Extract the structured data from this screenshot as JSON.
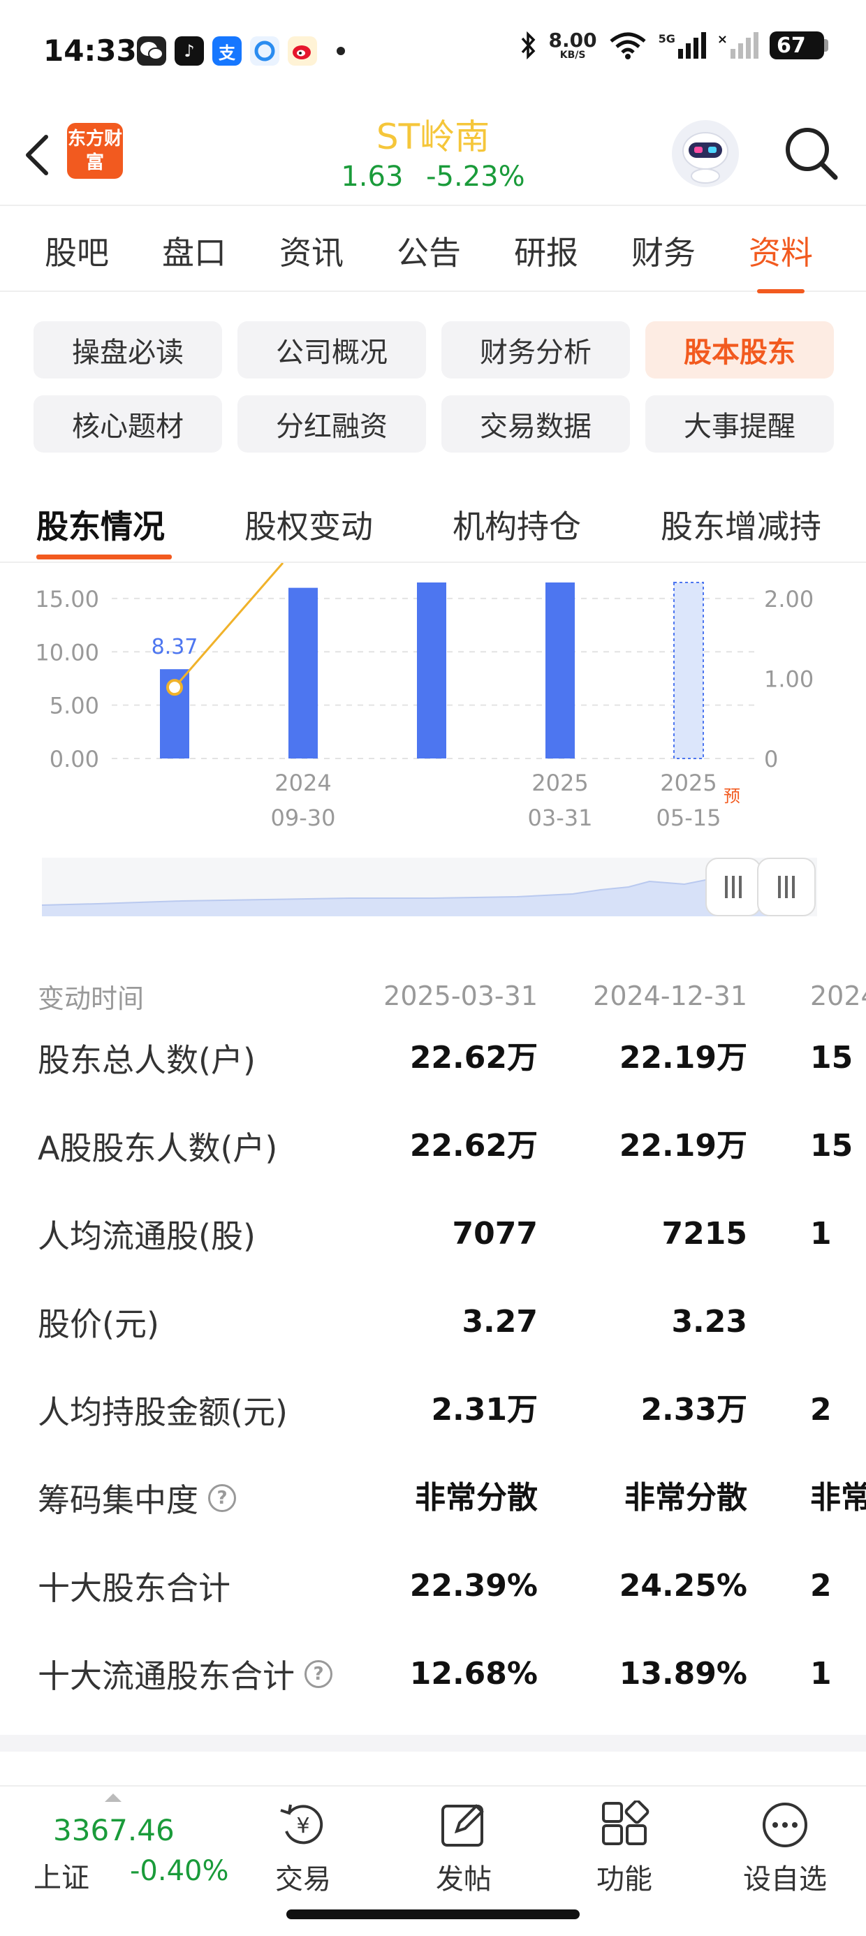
{
  "status_bar": {
    "time": "14:33",
    "net_speed": "8.00",
    "net_unit": "KB/S",
    "signal": "5G",
    "battery": "67"
  },
  "header": {
    "logo_text": "东方财富",
    "stock_name": "ST岭南",
    "price": "1.63",
    "change_pct": "-5.23%"
  },
  "main_tabs": [
    {
      "label": "股吧",
      "active": false
    },
    {
      "label": "盘口",
      "active": false
    },
    {
      "label": "资讯",
      "active": false
    },
    {
      "label": "公告",
      "active": false
    },
    {
      "label": "研报",
      "active": false
    },
    {
      "label": "财务",
      "active": false
    },
    {
      "label": "资料",
      "active": true
    }
  ],
  "chips": [
    {
      "label": "操盘必读",
      "active": false
    },
    {
      "label": "公司概况",
      "active": false
    },
    {
      "label": "财务分析",
      "active": false
    },
    {
      "label": "股本股东",
      "active": true
    },
    {
      "label": "核心题材",
      "active": false
    },
    {
      "label": "分红融资",
      "active": false
    },
    {
      "label": "交易数据",
      "active": false
    },
    {
      "label": "大事提醒",
      "active": false
    }
  ],
  "sub_tabs": [
    {
      "label": "股东情况",
      "active": true
    },
    {
      "label": "股权变动",
      "active": false
    },
    {
      "label": "机构持仓",
      "active": false
    },
    {
      "label": "股东增减持",
      "active": false
    }
  ],
  "chart_data": {
    "type": "bar",
    "left_axis_ticks": [
      "15.00",
      "10.00",
      "5.00",
      "0.00"
    ],
    "right_axis_ticks": [
      "2.00",
      "1.00",
      "0"
    ],
    "ylim_left": [
      0,
      16.5
    ],
    "ylim_right": [
      0,
      2.2
    ],
    "bars": [
      {
        "value": 8.37,
        "label": "8.37",
        "estimated": false
      },
      {
        "value": 16,
        "label": "",
        "estimated": false
      },
      {
        "value": 16.5,
        "label": "",
        "estimated": false
      },
      {
        "value": 16.5,
        "label": "",
        "estimated": false
      },
      {
        "value": 16.5,
        "label": "",
        "estimated": true
      }
    ],
    "x_tick_labels": [
      {
        "bar": 1,
        "year": "2024",
        "date": "09-30"
      },
      {
        "bar": 3,
        "year": "2025",
        "date": "03-31"
      },
      {
        "bar": 4,
        "year": "2025",
        "date": "05-15"
      }
    ],
    "estimate_tag": "预",
    "bar_color": "#4d76f0",
    "line_color": "#f0b22a"
  },
  "table": {
    "header_label": "变动时间",
    "columns": [
      "2025-03-31",
      "2024-12-31",
      "2024"
    ],
    "rows": [
      {
        "label": "股东总人数(户)",
        "help": false,
        "values": [
          "22.62万",
          "22.19万",
          "15"
        ]
      },
      {
        "label": "A股股东人数(户)",
        "help": false,
        "values": [
          "22.62万",
          "22.19万",
          "15"
        ]
      },
      {
        "label": "人均流通股(股)",
        "help": false,
        "values": [
          "7077",
          "7215",
          "1"
        ]
      },
      {
        "label": "股价(元)",
        "help": false,
        "values": [
          "3.27",
          "3.23",
          ""
        ]
      },
      {
        "label": "人均持股金额(元)",
        "help": false,
        "values": [
          "2.31万",
          "2.33万",
          "2"
        ]
      },
      {
        "label": "筹码集中度",
        "help": true,
        "values": [
          "非常分散",
          "非常分散",
          "非常"
        ]
      },
      {
        "label": "十大股东合计",
        "help": false,
        "values": [
          "22.39%",
          "24.25%",
          "2"
        ]
      },
      {
        "label": "十大流通股东合计",
        "help": true,
        "values": [
          "12.68%",
          "13.89%",
          "1"
        ]
      }
    ]
  },
  "bottom_bar": {
    "index_price": "3367.46",
    "index_name": "上证",
    "index_change": "-0.40%",
    "items": [
      {
        "label": "交易",
        "icon": "yuan-refresh-icon"
      },
      {
        "label": "发帖",
        "icon": "edit-icon"
      },
      {
        "label": "功能",
        "icon": "grid-icon"
      },
      {
        "label": "设自选",
        "icon": "more-icon"
      }
    ]
  },
  "colors": {
    "accent": "#f25a1f",
    "down": "#1a9b3a",
    "stock_name": "#f5c63a"
  }
}
